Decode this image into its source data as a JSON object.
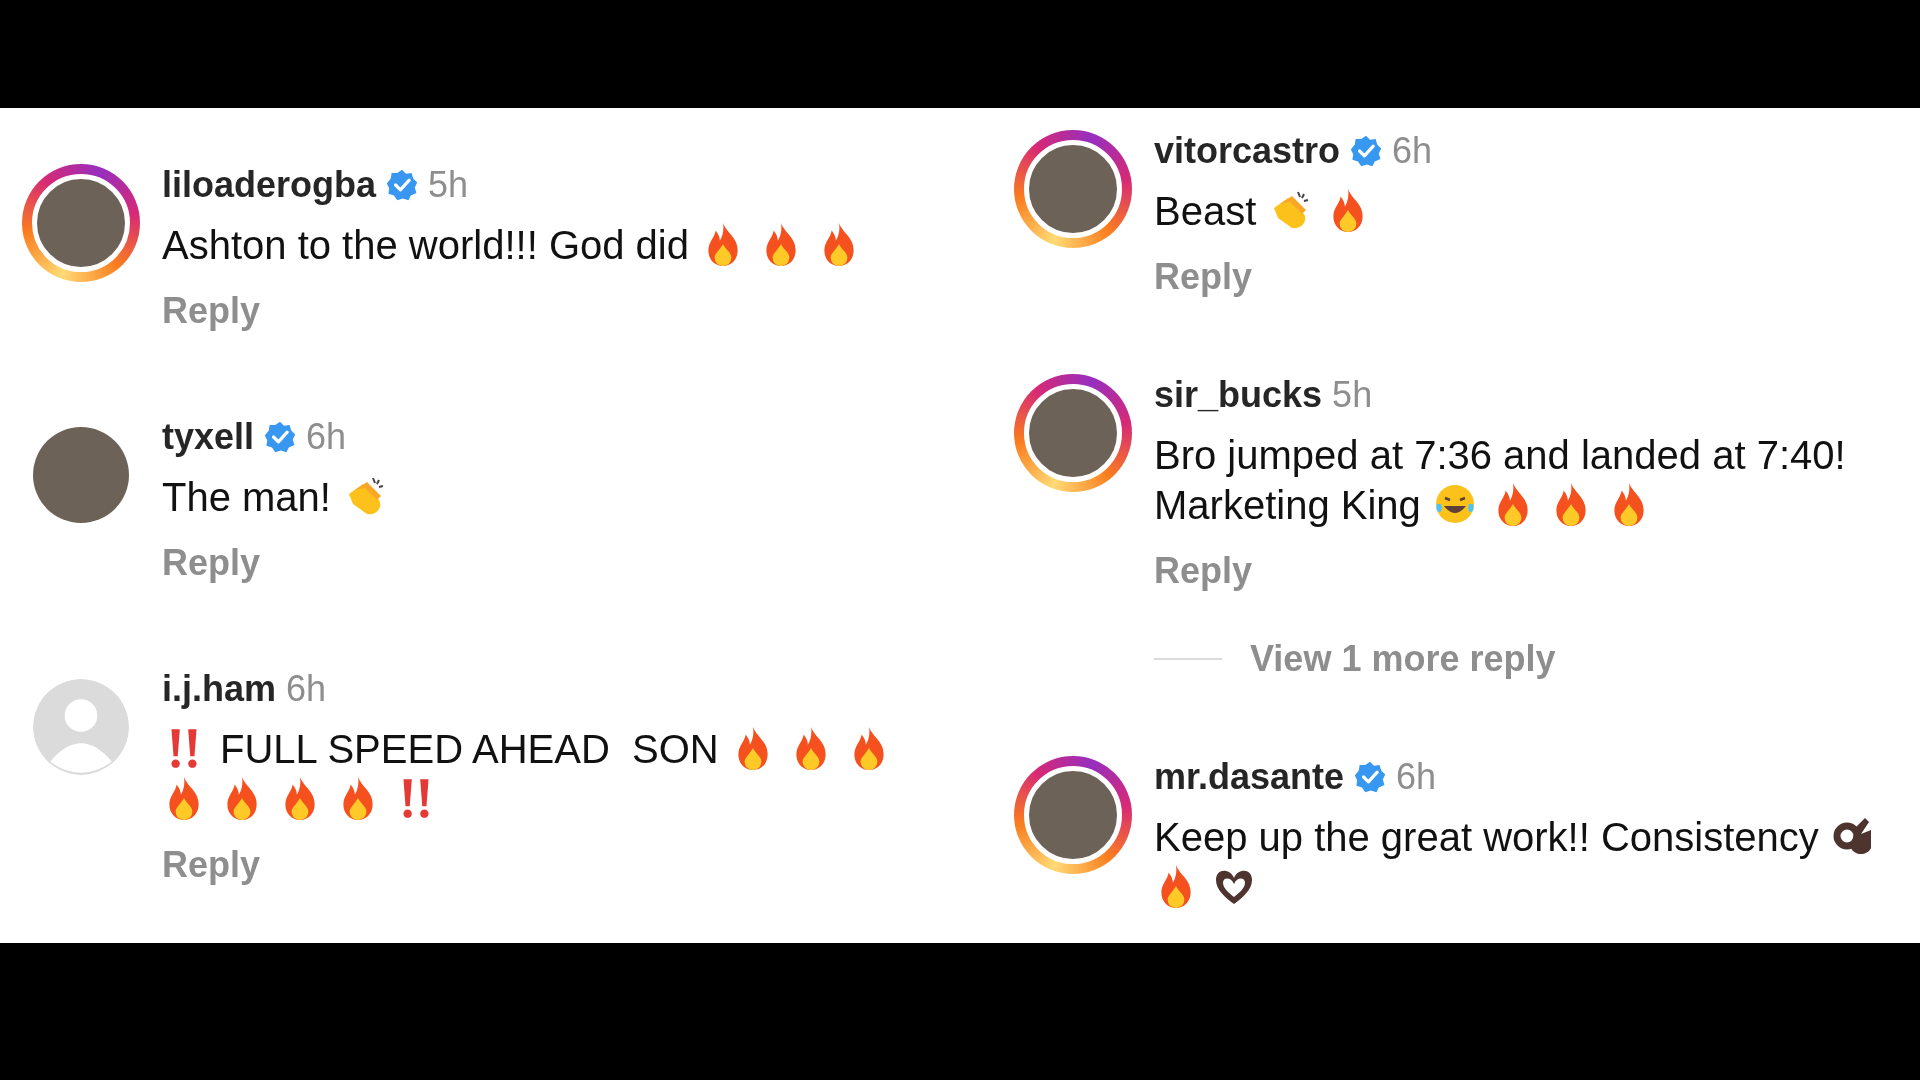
{
  "columns": [
    {
      "comments": [
        {
          "username": "liloaderogba",
          "verified": true,
          "time": "5h",
          "avatar": {
            "kind": "photo",
            "story_ring": true
          },
          "parts": [
            {
              "kind": "text",
              "text": "Ashton to the world!!! God did"
            },
            {
              "kind": "fire"
            },
            {
              "kind": "fire"
            },
            {
              "kind": "fire"
            }
          ],
          "reply": "Reply"
        },
        {
          "username": "tyxell",
          "verified": true,
          "time": "6h",
          "avatar": {
            "kind": "photo",
            "story_ring": false
          },
          "parts": [
            {
              "kind": "text",
              "text": "The man!"
            },
            {
              "kind": "clap"
            }
          ],
          "reply": "Reply"
        },
        {
          "username": "i.j.ham",
          "verified": false,
          "time": "6h",
          "avatar": {
            "kind": "default",
            "story_ring": false
          },
          "parts": [
            {
              "kind": "bangbang"
            },
            {
              "kind": "text",
              "text": "FULL SPEED AHEAD  SON"
            },
            {
              "kind": "fire"
            },
            {
              "kind": "fire"
            },
            {
              "kind": "fire"
            },
            {
              "kind": "fire"
            },
            {
              "kind": "fire"
            },
            {
              "kind": "fire"
            },
            {
              "kind": "fire"
            },
            {
              "kind": "bangbang"
            }
          ],
          "reply": "Reply"
        }
      ]
    },
    {
      "comments": [
        {
          "username": "vitorcastro",
          "verified": true,
          "time": "6h",
          "avatar": {
            "kind": "photo",
            "story_ring": true
          },
          "parts": [
            {
              "kind": "text",
              "text": "Beast"
            },
            {
              "kind": "clap"
            },
            {
              "kind": "fire"
            }
          ],
          "reply": "Reply"
        },
        {
          "username": "sir_bucks",
          "verified": false,
          "time": "5h",
          "avatar": {
            "kind": "photo",
            "story_ring": true
          },
          "parts": [
            {
              "kind": "text",
              "text": "Bro jumped at 7:36 and landed at 7:40!"
            },
            {
              "kind": "text",
              "text": "Marketing King"
            },
            {
              "kind": "laugh"
            },
            {
              "kind": "fire"
            },
            {
              "kind": "fire"
            },
            {
              "kind": "fire"
            }
          ],
          "reply": "Reply",
          "more_replies": "View 1 more reply"
        },
        {
          "username": "mr.dasante",
          "verified": true,
          "time": "6h",
          "avatar": {
            "kind": "photo",
            "story_ring": true
          },
          "parts": [
            {
              "kind": "text",
              "text": "Keep up the great work!! Consistency"
            },
            {
              "kind": "okhand"
            },
            {
              "kind": "fire"
            },
            {
              "kind": "hearthands"
            }
          ]
        }
      ]
    }
  ]
}
